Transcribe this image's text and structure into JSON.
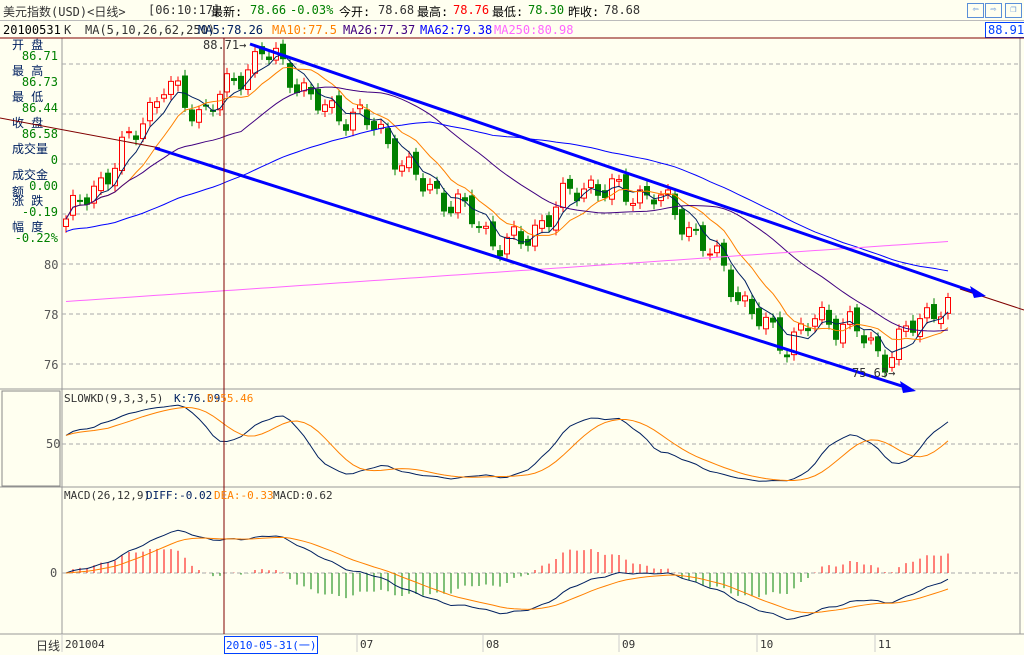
{
  "header": {
    "title": "美元指数(USD)<日线>",
    "time": "[06:10:17]",
    "latest_label": "最新:",
    "latest": "78.66",
    "change": "-0.03%",
    "open_label": "今开:",
    "open": "78.68",
    "high_label": "最高:",
    "high": "78.76",
    "low_label": "最低:",
    "low": "78.30",
    "prev_label": "昨收:",
    "prev": "78.68",
    "nav_prev": "⇦",
    "nav_next": "⇨",
    "restore": "❐"
  },
  "indicator_bar": {
    "date": "20100531",
    "k": "K",
    "ma_params": "MA(5,10,26,62,250)",
    "ma5": "MA5:78.26",
    "ma10": "MA10:77.5",
    "ma26": "MA26:77.37",
    "ma62": "MA62:79.38",
    "ma250": "MA250:80.98",
    "price_box": "88.91"
  },
  "info_panel": [
    {
      "label": "开  盘",
      "value": "86.71"
    },
    {
      "label": "最  高",
      "value": "86.73"
    },
    {
      "label": "最  低",
      "value": "86.44"
    },
    {
      "label": "收  盘",
      "value": "86.58"
    },
    {
      "label": "成交量",
      "value": "0"
    },
    {
      "label": "成交金额",
      "value": "0.00"
    },
    {
      "label": "涨  跌",
      "value": "-0.19"
    },
    {
      "label": "幅  度",
      "value": "-0.22%"
    }
  ],
  "annotations": {
    "high_mark": "88.71→",
    "low_mark": "75.63→"
  },
  "kd": {
    "title": "SLOWKD(9,3,3,5)",
    "k": "K:76.09",
    "d": "D:55.46",
    "level": "50"
  },
  "macd": {
    "title": "MACD(26,12,9)",
    "diff": "DIFF:-0.02",
    "dea": "DEA:-0.33",
    "macd": "MACD:0.62",
    "level": "0"
  },
  "footer": {
    "period": "日线",
    "cursor_date": "2010-05-31(一)"
  },
  "colors": {
    "bg": "#FFFFF0",
    "up": "#FF0000",
    "down": "#008000",
    "ma5": "#002060",
    "ma10": "#FF8000",
    "ma26": "#400080",
    "ma62": "#0000FF",
    "ma250": "#FF66FF",
    "channel": "#0000FF"
  },
  "chart_data": {
    "type": "candlestick",
    "y_ticks": [
      80,
      78,
      76
    ],
    "x_ticks": [
      "201004",
      "07",
      "08",
      "09",
      "10",
      "11"
    ],
    "ylim": [
      75,
      89
    ],
    "approx_close_path": [
      81.8,
      83.2,
      85,
      87.2,
      86,
      87,
      88.6,
      87.4,
      86,
      86,
      84.6,
      83,
      82.4,
      81,
      80.8,
      82.4,
      83.2,
      82.8,
      82.8,
      81.6,
      80,
      78,
      76.8,
      77.8,
      77.6,
      76.2,
      77.6,
      78.66
    ],
    "high": 88.71,
    "low": 75.63,
    "last": 78.66
  }
}
